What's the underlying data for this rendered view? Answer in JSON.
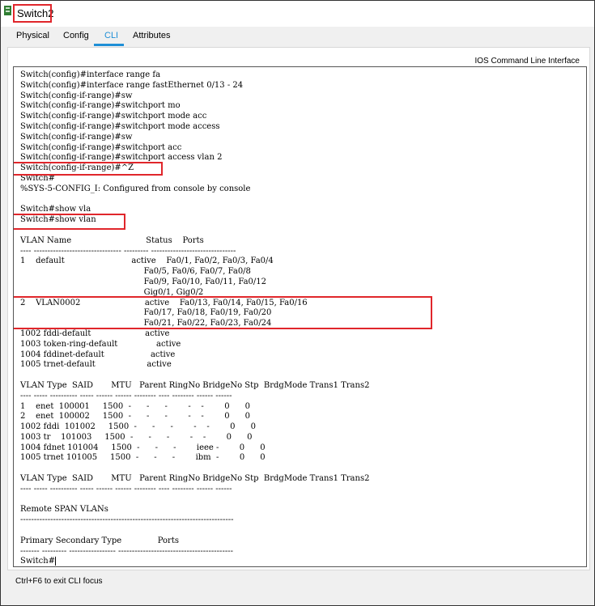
{
  "window": {
    "title": "Switch2"
  },
  "tabs": [
    {
      "label": "Physical"
    },
    {
      "label": "Config"
    },
    {
      "label": "CLI",
      "active": true
    },
    {
      "label": "Attributes"
    }
  ],
  "panel": {
    "header": "IOS Command Line Interface"
  },
  "terminal": {
    "lines": [
      "Switch(config)#interface range fa",
      "Switch(config)#interface range fastEthernet 0/13 - 24",
      "Switch(config-if-range)#sw",
      "Switch(config-if-range)#switchport mo",
      "Switch(config-if-range)#switchport mode acc",
      "Switch(config-if-range)#switchport mode access",
      "Switch(config-if-range)#sw",
      "Switch(config-if-range)#switchport acc",
      "Switch(config-if-range)#switchport access vlan 2",
      "Switch(config-if-range)#^Z",
      "Switch#",
      "%SYS-5-CONFIG_I: Configured from console by console",
      "",
      "Switch#show vla",
      "Switch#show vlan",
      "",
      "VLAN Name                             Status    Ports",
      "---- -------------------------------- --------- -------------------------------",
      "1    default                          active    Fa0/1, Fa0/2, Fa0/3, Fa0/4",
      "                                                Fa0/5, Fa0/6, Fa0/7, Fa0/8",
      "                                                Fa0/9, Fa0/10, Fa0/11, Fa0/12",
      "                                                Gig0/1, Gig0/2",
      "2    VLAN0002                         active    Fa0/13, Fa0/14, Fa0/15, Fa0/16",
      "                                                Fa0/17, Fa0/18, Fa0/19, Fa0/20",
      "                                                Fa0/21, Fa0/22, Fa0/23, Fa0/24",
      "1002 fddi-default                     active",
      "1003 token-ring-default               active",
      "1004 fddinet-default                  active",
      "1005 trnet-default                    active",
      "",
      "VLAN Type  SAID       MTU   Parent RingNo BridgeNo Stp  BrdgMode Trans1 Trans2",
      "---- ----- ---------- ----- ------ ------ -------- ---- -------- ------ ------",
      "1    enet  100001     1500  -      -      -        -    -        0      0",
      "2    enet  100002     1500  -      -      -        -    -        0      0",
      "1002 fddi  101002     1500  -      -      -        -    -        0      0",
      "1003 tr    101003     1500  -      -      -        -    -        0      0",
      "1004 fdnet 101004     1500  -      -      -        ieee -        0      0",
      "1005 trnet 101005     1500  -      -      -        ibm  -        0      0",
      "",
      "VLAN Type  SAID       MTU   Parent RingNo BridgeNo Stp  BrdgMode Trans1 Trans2",
      "---- ----- ---------- ----- ------ ------ -------- ---- -------- ------ ------",
      "",
      "Remote SPAN VLANs",
      "------------------------------------------------------------------------------",
      "",
      "Primary Secondary Type              Ports",
      "------- --------- ----------------- ------------------------------------------",
      "Switch#"
    ]
  },
  "footer": {
    "hint": "Ctrl+F6 to exit CLI focus"
  }
}
